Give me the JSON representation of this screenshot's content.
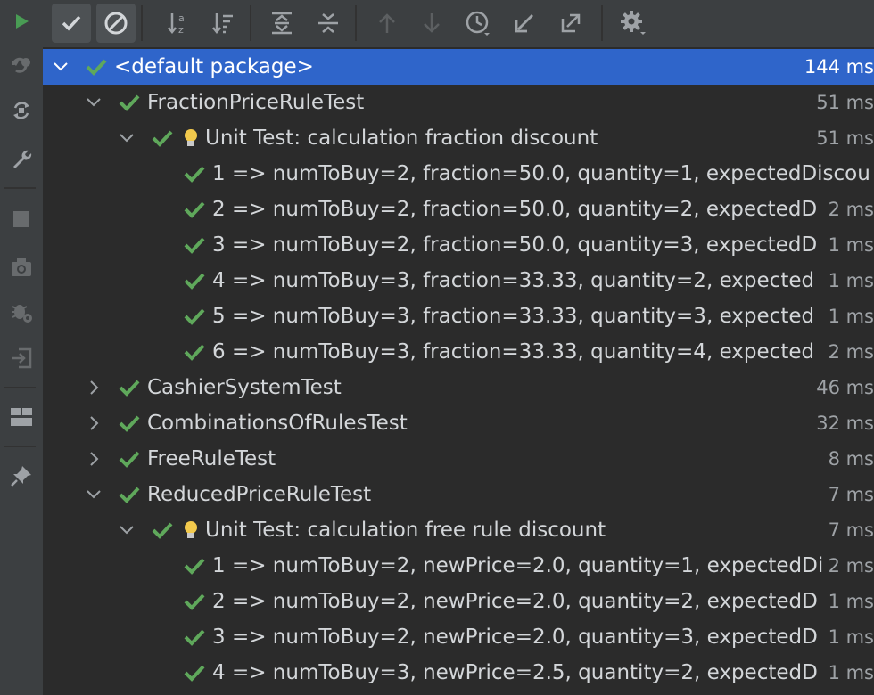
{
  "toolbar": {
    "buttons": [
      {
        "icon": "show-passed-icon",
        "pressed": true
      },
      {
        "icon": "show-ignored-icon",
        "pressed": true
      },
      {
        "icon": "sort-alphabetically-icon"
      },
      {
        "icon": "sort-by-duration-icon"
      },
      {
        "icon": "expand-all-icon"
      },
      {
        "icon": "collapse-all-icon"
      },
      {
        "icon": "previous-failed-icon"
      },
      {
        "icon": "next-failed-icon"
      },
      {
        "icon": "test-history-icon"
      },
      {
        "icon": "import-tests-icon"
      },
      {
        "icon": "export-tests-icon"
      },
      {
        "icon": "settings-icon"
      }
    ]
  },
  "side_toolbar": {
    "buttons": [
      "run-icon",
      "rerun-failed-icon",
      "toggle-auto-test-icon",
      "wrench-icon",
      "stop-icon",
      "screenshot-icon",
      "debug-settings-icon",
      "exit-icon",
      "layout-icon",
      "pin-icon"
    ]
  },
  "colors": {
    "pass": "#5fa85b",
    "selection": "#2f65ca",
    "background": "#2b2b2b",
    "toolbar": "#3c3f41",
    "bulb": "#f2c94c"
  },
  "tree": {
    "rows": [
      {
        "label": "<default package>",
        "time": "144 ms",
        "expanded": true,
        "selected": true
      },
      {
        "label": "FractionPriceRuleTest",
        "time": "51 ms",
        "expanded": true
      },
      {
        "label": "Unit Test: calculation fraction discount",
        "time": "51 ms",
        "expanded": true
      },
      {
        "label": "1 => numToBuy=2, fraction=50.0, quantity=1, expectedDiscou",
        "time": ""
      },
      {
        "label": "2 => numToBuy=2, fraction=50.0, quantity=2, expectedD",
        "time": "2 ms"
      },
      {
        "label": "3 => numToBuy=2, fraction=50.0, quantity=3, expectedD",
        "time": "1 ms"
      },
      {
        "label": "4 => numToBuy=3, fraction=33.33, quantity=2, expected",
        "time": "1 ms"
      },
      {
        "label": "5 => numToBuy=3, fraction=33.33, quantity=3, expected",
        "time": "1 ms"
      },
      {
        "label": "6 => numToBuy=3, fraction=33.33, quantity=4, expected",
        "time": "2 ms"
      },
      {
        "label": "CashierSystemTest",
        "time": "46 ms",
        "expanded": false
      },
      {
        "label": "CombinationsOfRulesTest",
        "time": "32 ms",
        "expanded": false
      },
      {
        "label": "FreeRuleTest",
        "time": "8 ms",
        "expanded": false
      },
      {
        "label": "ReducedPriceRuleTest",
        "time": "7 ms",
        "expanded": true
      },
      {
        "label": "Unit Test: calculation free rule discount",
        "time": "7 ms",
        "expanded": true
      },
      {
        "label": "1 => numToBuy=2, newPrice=2.0, quantity=1, expectedDi",
        "time": "2 ms"
      },
      {
        "label": "2 => numToBuy=2, newPrice=2.0, quantity=2, expectedD",
        "time": "1 ms"
      },
      {
        "label": "3 => numToBuy=2, newPrice=2.0, quantity=3, expectedD",
        "time": "1 ms"
      },
      {
        "label": "4 => numToBuy=3, newPrice=2.5, quantity=2, expectedD",
        "time": "1 ms"
      }
    ]
  }
}
